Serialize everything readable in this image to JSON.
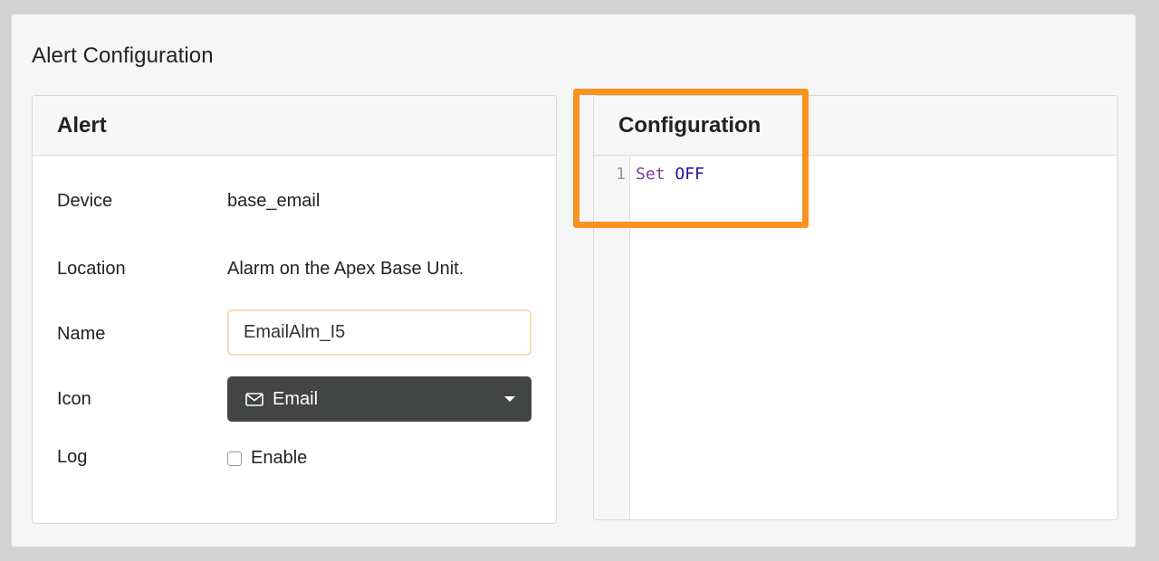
{
  "page": {
    "title": "Alert Configuration"
  },
  "alert_panel": {
    "header": "Alert",
    "fields": {
      "device": {
        "label": "Device",
        "value": "base_email"
      },
      "location": {
        "label": "Location",
        "value": "Alarm on the Apex Base Unit."
      },
      "name": {
        "label": "Name",
        "value": "EmailAlm_I5"
      },
      "icon": {
        "label": "Icon",
        "value": "Email",
        "icon_name": "envelope-icon"
      },
      "log": {
        "label": "Log",
        "checkbox_label": "Enable",
        "checked": false
      }
    }
  },
  "config_panel": {
    "header": "Configuration",
    "lines": [
      {
        "number": "1",
        "keyword": "Set",
        "argument": "OFF"
      }
    ]
  },
  "colors": {
    "highlight": "#f7931e",
    "select_bg": "#434545",
    "keyword": "#7a3e9d",
    "atom": "#221199"
  }
}
